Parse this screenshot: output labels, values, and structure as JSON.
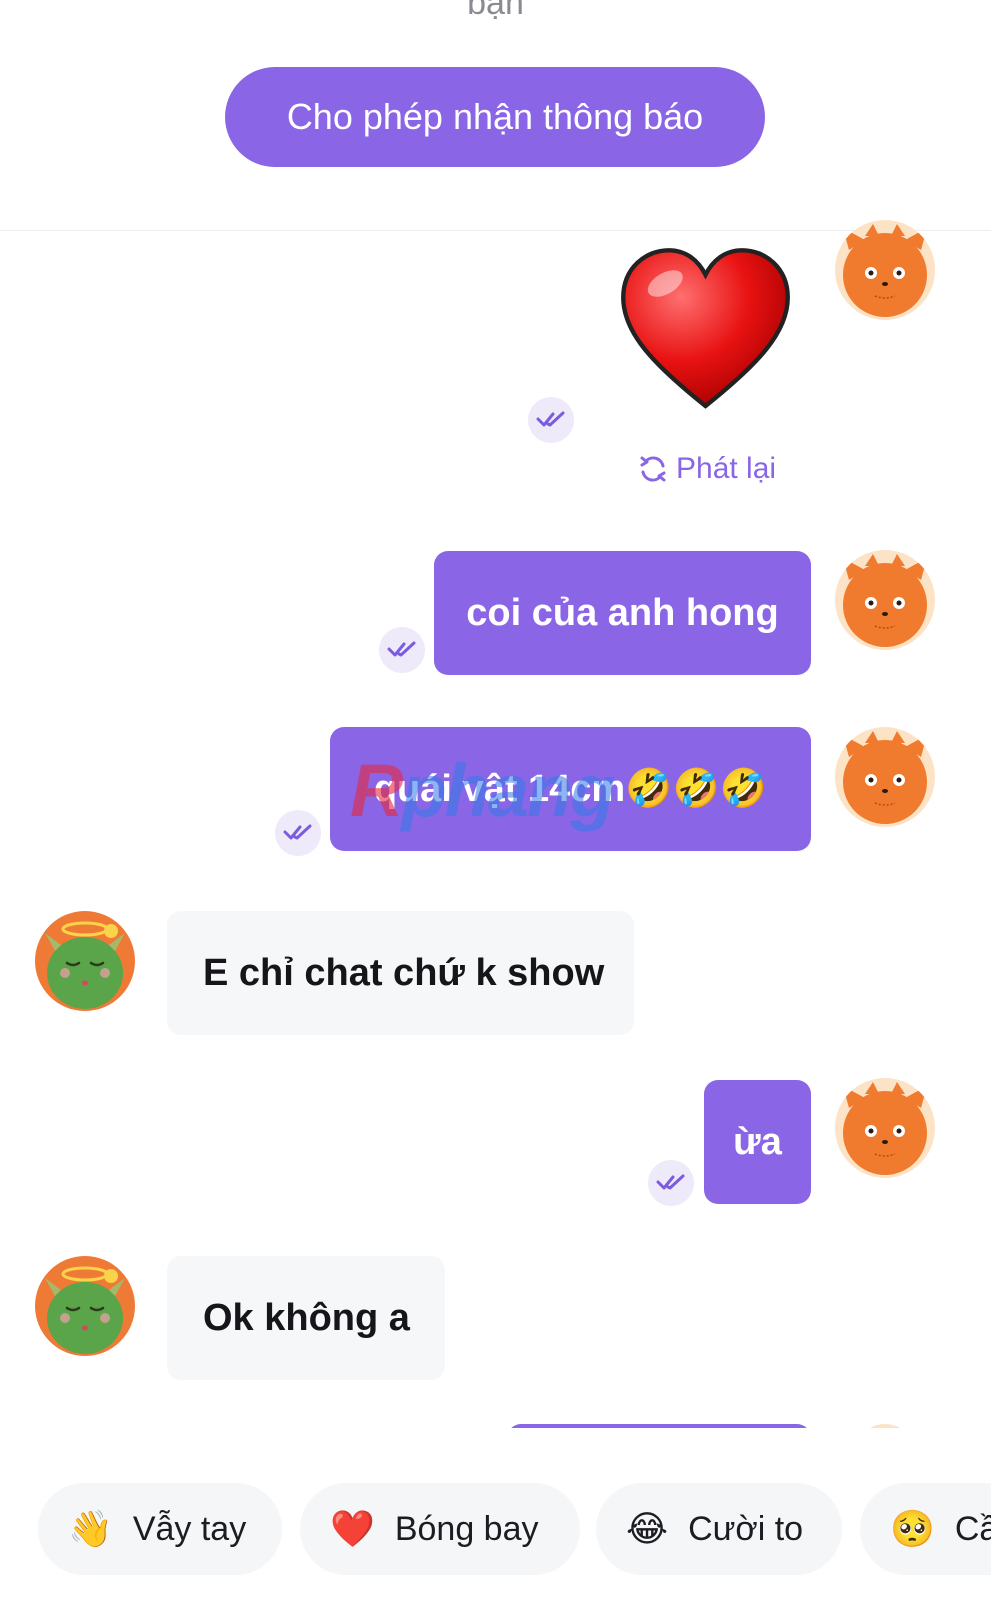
{
  "top": {
    "cut_text": "bạn",
    "allow_button": "Cho phép nhận thông báo"
  },
  "messages": {
    "replay_label": "Phát lại",
    "sent_1": "coi của anh hong",
    "sent_2": "quái vật 14cm🤣🤣🤣",
    "recv_1": "E chỉ chat chứ k show",
    "sent_3": "ừa",
    "recv_2": "Ok không a"
  },
  "watermark": {
    "prefix": "R",
    "rest": "phang"
  },
  "quick_replies": [
    {
      "emoji": "👋",
      "label": "Vẫy tay",
      "icon": "wave-icon"
    },
    {
      "emoji": "❤️",
      "label": "Bóng bay",
      "icon": "heart-icon"
    },
    {
      "emoji": "😂",
      "label": "Cười to",
      "icon": "laugh-icon"
    },
    {
      "emoji": "🥺",
      "label": "Cầ",
      "icon": "pleading-icon"
    }
  ],
  "colors": {
    "accent": "#8a66e6",
    "received_bubble": "#f6f7f9",
    "tick_bg": "#efeaf9"
  }
}
